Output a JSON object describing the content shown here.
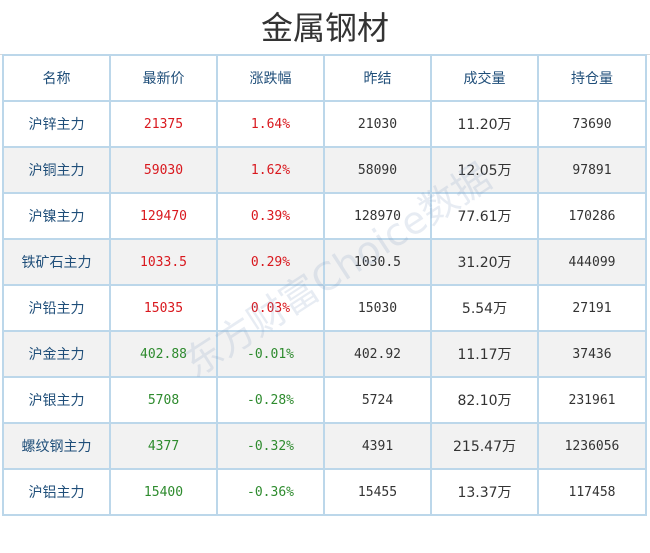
{
  "title": "金属钢材",
  "watermark": "东方财富Choice数据",
  "headers": [
    "名称",
    "最新价",
    "涨跌幅",
    "昨结",
    "成交量",
    "持仓量"
  ],
  "rows": [
    {
      "name": "沪锌主力",
      "price": "21375",
      "change": "1.64%",
      "prev": "21030",
      "volume": "11.20万",
      "oi": "73690",
      "dir": "up"
    },
    {
      "name": "沪铜主力",
      "price": "59030",
      "change": "1.62%",
      "prev": "58090",
      "volume": "12.05万",
      "oi": "97891",
      "dir": "up"
    },
    {
      "name": "沪镍主力",
      "price": "129470",
      "change": "0.39%",
      "prev": "128970",
      "volume": "77.61万",
      "oi": "170286",
      "dir": "up"
    },
    {
      "name": "铁矿石主力",
      "price": "1033.5",
      "change": "0.29%",
      "prev": "1030.5",
      "volume": "31.20万",
      "oi": "444099",
      "dir": "up"
    },
    {
      "name": "沪铅主力",
      "price": "15035",
      "change": "0.03%",
      "prev": "15030",
      "volume": "5.54万",
      "oi": "27191",
      "dir": "up"
    },
    {
      "name": "沪金主力",
      "price": "402.88",
      "change": "-0.01%",
      "prev": "402.92",
      "volume": "11.17万",
      "oi": "37436",
      "dir": "down"
    },
    {
      "name": "沪银主力",
      "price": "5708",
      "change": "-0.28%",
      "prev": "5724",
      "volume": "82.10万",
      "oi": "231961",
      "dir": "down"
    },
    {
      "name": "螺纹钢主力",
      "price": "4377",
      "change": "-0.32%",
      "prev": "4391",
      "volume": "215.47万",
      "oi": "1236056",
      "dir": "down"
    },
    {
      "name": "沪铝主力",
      "price": "15400",
      "change": "-0.36%",
      "prev": "15455",
      "volume": "13.37万",
      "oi": "117458",
      "dir": "down"
    }
  ],
  "colors": {
    "up": "#d9181e",
    "down": "#2e8b2e",
    "header_text": "#1f4e79",
    "border": "#bcd7ea"
  }
}
